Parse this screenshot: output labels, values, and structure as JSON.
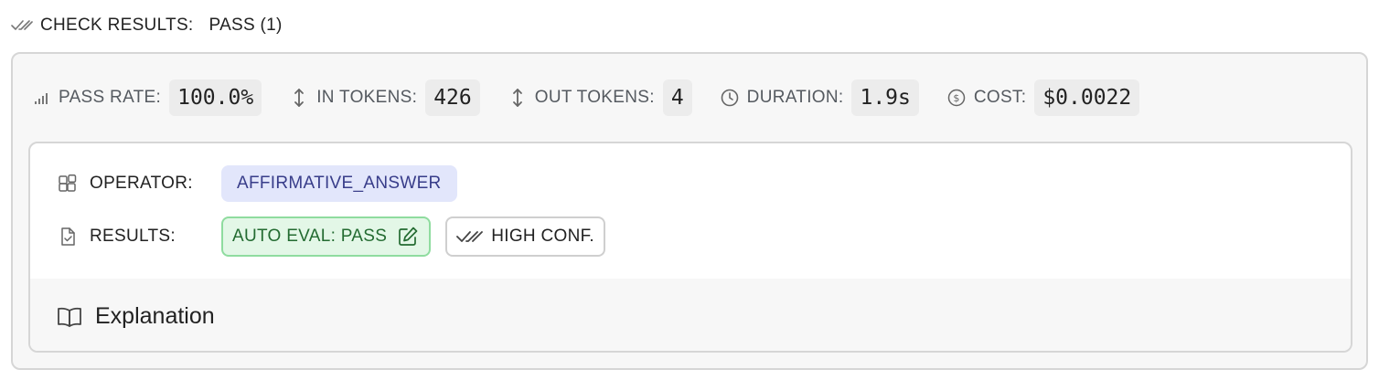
{
  "header": {
    "title": "CHECK RESULTS:",
    "status": "PASS (1)",
    "icon": "double-check-icon"
  },
  "stats": [
    {
      "icon": "bars-icon",
      "label": "PASS RATE:",
      "value": "100.0%"
    },
    {
      "icon": "vertical-arrows-icon",
      "label": "IN TOKENS:",
      "value": "426"
    },
    {
      "icon": "vertical-arrows-icon",
      "label": "OUT TOKENS:",
      "value": "4"
    },
    {
      "icon": "clock-icon",
      "label": "DURATION:",
      "value": "1.9s"
    },
    {
      "icon": "dollar-circle-icon",
      "label": "COST:",
      "value": "$0.0022"
    }
  ],
  "operator": {
    "icon": "blocks-icon",
    "label": "OPERATOR:",
    "value": "AFFIRMATIVE_ANSWER"
  },
  "results": {
    "icon": "file-check-icon",
    "label": "RESULTS:",
    "eval": "AUTO EVAL: PASS",
    "confidence": "HIGH CONF."
  },
  "explanation": {
    "icon": "book-icon",
    "label": "Explanation"
  },
  "colors": {
    "pass_bg": "#e3f7e7",
    "pass_border": "#8fdc9f",
    "pass_text": "#236b31",
    "operator_bg": "#e2e6fb",
    "operator_text": "#383d8a"
  }
}
